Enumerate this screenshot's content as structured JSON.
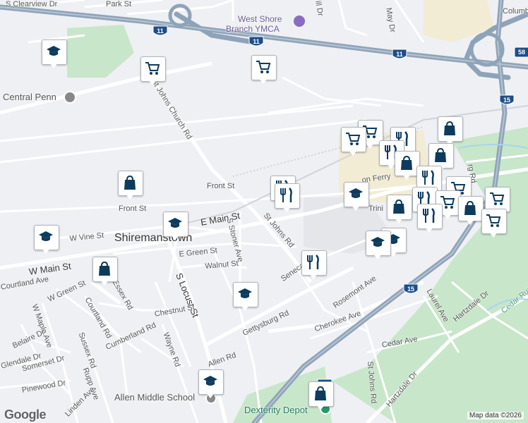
{
  "map": {
    "town_label": "Shiremanstown",
    "streets": {
      "e_main": "E Main St",
      "w_main": "W Main St",
      "front_st_1": "Front St",
      "front_st_2": "Front St",
      "w_vine": "W Vine St",
      "e_green": "E Green St",
      "walnut": "Walnut St",
      "s_stoner": "S Stoner Ave",
      "st_johns": "St Johns Rd",
      "st_johns_church": "St Johns Church Rd",
      "s_locust": "S Locust St",
      "chestnut": "Chestnut St",
      "wayne": "Wayne Rd",
      "cumberland": "Cumberland Rd",
      "courtland_ave": "Courtland Ave",
      "courtland_rd": "Courtland Rd",
      "essex": "Essex Rd",
      "w_green": "W Green St",
      "w_maple": "W Maple Ave",
      "belaire": "Belaire Dr",
      "glendale": "Glendale Dr",
      "somerset": "Somerset Dr",
      "pinewood": "Pinewood Dr",
      "sussex": "Sussex Rd",
      "rupp": "Rupp Ave",
      "linden": "Linden Ave",
      "allen": "Allen Rd",
      "gettysburg": "Gettysburg Rd",
      "seneca": "Seneca",
      "rosemont": "Rosemont Ave",
      "cherokee": "Cherokee Ave",
      "cedar": "Cedar Ave",
      "st_johns_rd_s": "St Johns Rd",
      "hartzdale_1": "Hartzdale Dr",
      "hartzdale_2": "Hartzdale Dr",
      "laurel": "Laurel Ave",
      "park": "Park St",
      "clearview": "S Clearview Dr",
      "columbus": "Columbus",
      "may": "May Dr",
      "hill": "ill Dr",
      "lon_ferry": "on Ferry",
      "trinity": "Trini",
      "cedar_run": "Cedar Run",
      "rg_rd": "rg Rd"
    },
    "pois": {
      "ymca_line1": "West Shore",
      "ymca_line2": "Branch YMCA",
      "central_penn": "Central Penn",
      "allen_ms": "Allen Middle School",
      "dexterity": "Dexterity Depot"
    },
    "shields": {
      "us11_a": "11",
      "us11_b": "11",
      "us11_c": "11",
      "us15_a": "15",
      "us15_b": "15",
      "us15_c": "15",
      "ramp": "58"
    },
    "footer": {
      "logo": "Google",
      "attribution": "Map data ©2026"
    }
  },
  "markers": [
    {
      "icon": "school-icon"
    },
    {
      "icon": "shopping-cart-icon"
    },
    {
      "icon": "shopping-cart-icon"
    },
    {
      "icon": "shopping-bag-icon"
    },
    {
      "icon": "school-icon"
    },
    {
      "icon": "school-icon"
    },
    {
      "icon": "restaurant-icon"
    },
    {
      "icon": "restaurant-icon"
    },
    {
      "icon": "shopping-bag-icon"
    },
    {
      "icon": "restaurant-icon"
    },
    {
      "icon": "school-icon"
    },
    {
      "icon": "school-icon"
    },
    {
      "icon": "shopping-bag-icon"
    },
    {
      "icon": "school-icon"
    }
  ],
  "colors": {
    "background": "#eef0f3",
    "park_green": "#c8e6c9",
    "highway": "#8fa3b8",
    "marker_icon": "#0d3b5e",
    "poi_purple": "#8a6bbf",
    "poi_green": "#1f9a6b"
  }
}
